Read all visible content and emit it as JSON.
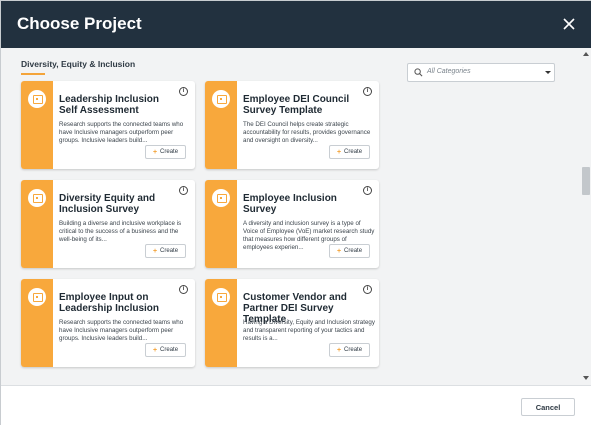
{
  "dialog": {
    "title": "Choose Project",
    "close_icon": "close-icon"
  },
  "section": {
    "title": "Diversity, Equity & Inclusion"
  },
  "filter": {
    "placeholder": "All Categories",
    "icon": "search-icon"
  },
  "cards": [
    {
      "title": "Leadership Inclusion Self Assessment",
      "description": "Research supports the connected teams who have Inclusive managers outperform peer groups. Inclusive leaders build...",
      "button": "Create",
      "info": "i"
    },
    {
      "title": "Employee DEI Council Survey Template",
      "description": "The DEI Council helps create strategic accountability for results, provides governance and oversight on diversity...",
      "button": "Create",
      "info": "i"
    },
    {
      "title": "Diversity Equity and Inclusion Survey",
      "description": "Building a diverse and inclusive workplace is critical to the success of a business and the well-being of its...",
      "button": "Create",
      "info": "i"
    },
    {
      "title": "Employee Inclusion Survey",
      "description": "A diversity and inclusion survey is a type of Voice of Employee (VoE) market research study that measures how different groups of employees experien...",
      "button": "Create",
      "info": "i"
    },
    {
      "title": "Employee Input on Leadership Inclusion",
      "description": "Research supports the connected teams who have Inclusive managers outperform peer groups. Inclusive leaders build...",
      "button": "Create",
      "info": "i"
    },
    {
      "title": "Customer Vendor and Partner DEI Survey Template",
      "description": "Having a Diversity, Equity and Inclusion strategy and transparent reporting of your tactics and results is a...",
      "button": "Create",
      "info": "i"
    }
  ],
  "footer": {
    "cancel": "Cancel"
  },
  "colors": {
    "header": "#22313f",
    "accent": "#f8a83c",
    "background": "#f2f3f4"
  }
}
